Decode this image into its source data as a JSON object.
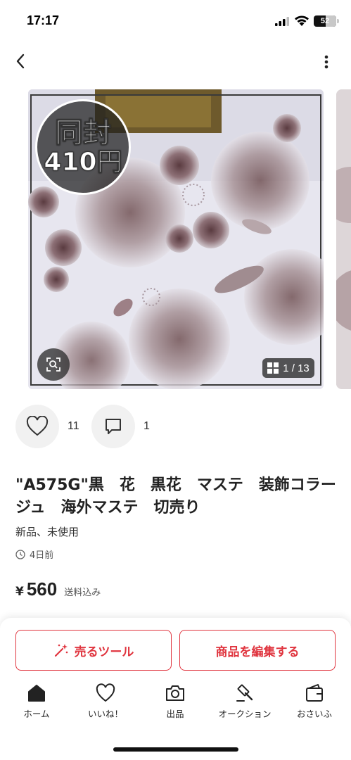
{
  "status_bar": {
    "time": "17:17",
    "battery": "52",
    "battery_level": 0.52
  },
  "nav": {
    "back_icon": "chevron-left-icon",
    "more_icon": "more-vertical-icon"
  },
  "gallery": {
    "promo_line1": "同封",
    "promo_line2": "410円",
    "counter": "1 / 13",
    "zoom_icon": "image-search-icon"
  },
  "engagement": {
    "likes": "11",
    "comments": "1"
  },
  "item": {
    "title": "\"A575G\"黒　花　黒花　マステ　装飾コラージュ　海外マステ　切売り",
    "condition": "新品、未使用",
    "posted": "4日前",
    "currency": "¥",
    "price": "560",
    "shipping": "送料込み"
  },
  "actions": {
    "sell_tool": "売るツール",
    "edit": "商品を編集する"
  },
  "tabs": [
    {
      "label": "ホーム",
      "icon": "home-icon"
    },
    {
      "label": "いいね！",
      "icon": "heart-icon"
    },
    {
      "label": "出品",
      "icon": "camera-icon"
    },
    {
      "label": "オークション",
      "icon": "gavel-icon"
    },
    {
      "label": "おさいふ",
      "icon": "wallet-icon"
    }
  ],
  "colors": {
    "accent": "#e0353f",
    "text": "#222222",
    "muted": "#555555"
  }
}
